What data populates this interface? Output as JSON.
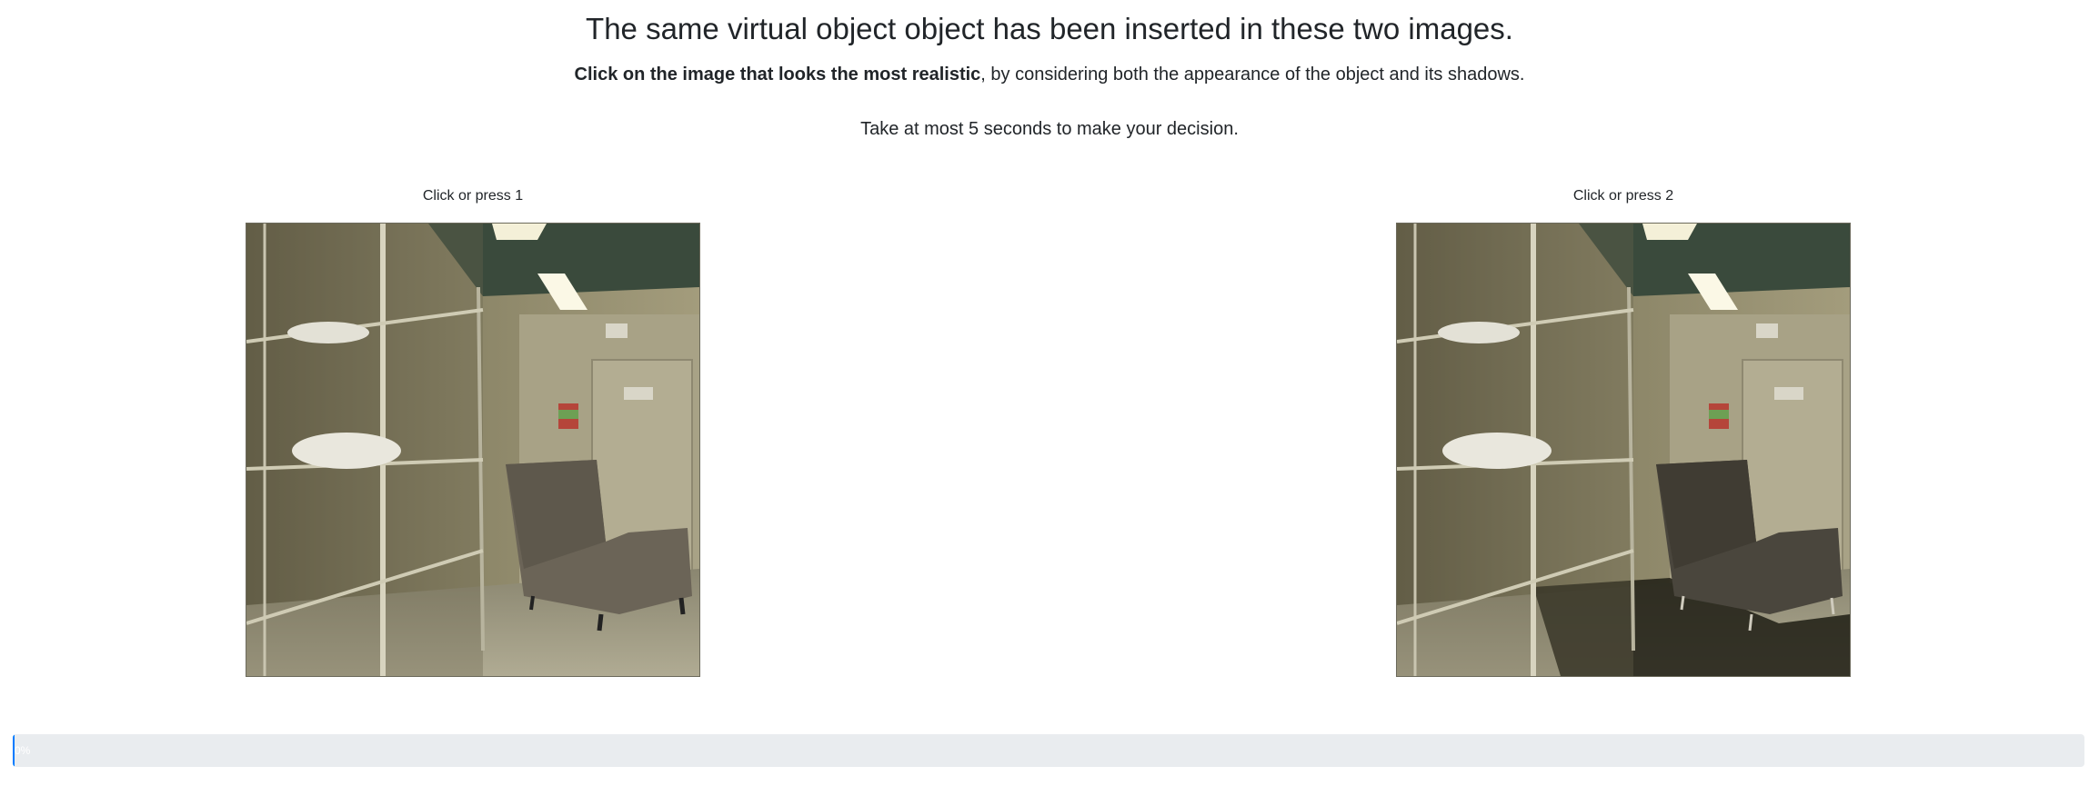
{
  "header": {
    "title": "The same virtual object object has been inserted in these two images.",
    "instruction_bold": "Click on the image that looks the most realistic",
    "instruction_rest": ", by considering both the appearance of the object and its shadows.",
    "time_note": "Take at most 5 seconds to make your decision."
  },
  "choices": [
    {
      "label": "Click or press 1",
      "image_alt": "Room with metal shelving and an inserted armchair, rendered without cast shadow"
    },
    {
      "label": "Click or press 2",
      "image_alt": "Room with metal shelving and an inserted armchair, rendered with a dark cast shadow"
    }
  ],
  "progress": {
    "percent": 0,
    "label": "0%"
  },
  "colors": {
    "progress_track": "#e9ecef",
    "progress_fill": "#007bff",
    "text": "#212529"
  }
}
